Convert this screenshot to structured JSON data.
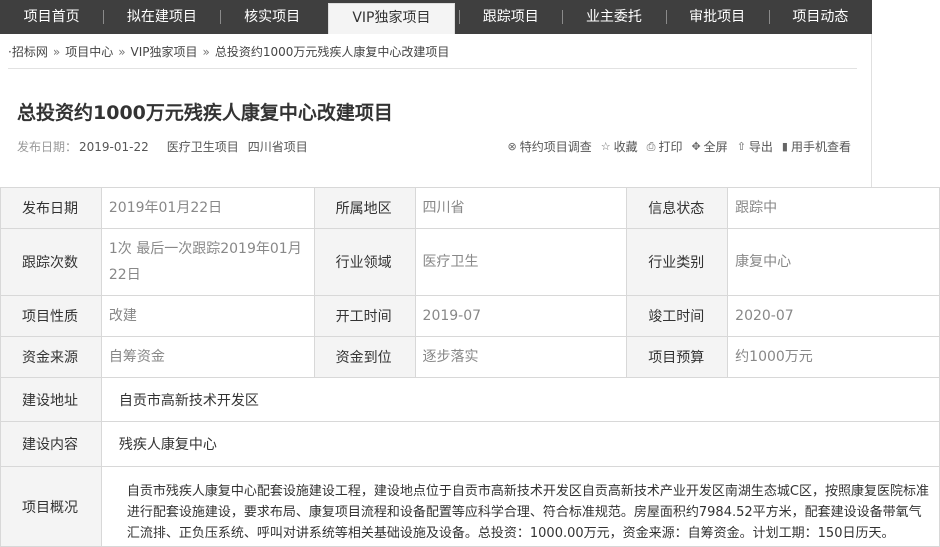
{
  "nav": {
    "items": [
      {
        "label": "项目首页"
      },
      {
        "label": "拟在建项目"
      },
      {
        "label": "核实项目"
      },
      {
        "label": "VIP独家项目"
      },
      {
        "label": "跟踪项目"
      },
      {
        "label": "业主委托"
      },
      {
        "label": "审批项目"
      },
      {
        "label": "项目动态"
      }
    ],
    "active_index": 3
  },
  "breadcrumb": {
    "bullet": "·",
    "items": [
      "招标网",
      "项目中心",
      "VIP独家项目",
      "总投资约1000万元残疾人康复中心改建项目"
    ],
    "separator": "»"
  },
  "header": {
    "title": "总投资约1000万元残疾人康复中心改建项目",
    "publish_label": "发布日期：",
    "publish_date": "2019-01-22",
    "tag_industry": "医疗卫生项目",
    "tag_region": "四川省项目"
  },
  "actions": [
    {
      "icon": "survey-icon",
      "glyph": "⊗",
      "label": "特约项目调查"
    },
    {
      "icon": "star-icon",
      "glyph": "☆",
      "label": "收藏"
    },
    {
      "icon": "print-icon",
      "glyph": "⎙",
      "label": "打印"
    },
    {
      "icon": "fullscreen-icon",
      "glyph": "✥",
      "label": "全屏"
    },
    {
      "icon": "export-icon",
      "glyph": "⇧",
      "label": "导出"
    },
    {
      "icon": "mobile-icon",
      "glyph": "▮",
      "label": "用手机查看"
    }
  ],
  "details": {
    "publish_date_label": "发布日期",
    "publish_date_value": "2019年01月22日",
    "region_label": "所属地区",
    "region_value": "四川省",
    "status_label": "信息状态",
    "status_value": "跟踪中",
    "track_label": "跟踪次数",
    "track_value": "1次 最后一次跟踪2019年01月22日",
    "industry_label": "行业领域",
    "industry_value": "医疗卫生",
    "category_label": "行业类别",
    "category_value": "康复中心",
    "nature_label": "项目性质",
    "nature_value": "改建",
    "start_label": "开工时间",
    "start_value": "2019-07",
    "end_label": "竣工时间",
    "end_value": "2020-07",
    "fund_source_label": "资金来源",
    "fund_source_value": "自筹资金",
    "fund_arrival_label": "资金到位",
    "fund_arrival_value": "逐步落实",
    "budget_label": "项目预算",
    "budget_value": "约1000万元",
    "address_label": "建设地址",
    "address_value": "自贡市高新技术开发区",
    "content_label": "建设内容",
    "content_value": "残疾人康复中心",
    "overview_label": "项目概况",
    "overview_value": "自贡市残疾人康复中心配套设施建设工程，建设地点位于自贡市高新技术开发区自贡高新技术产业开发区南湖生态城C区，按照康复医院标准进行配套设施建设，要求布局、康复项目流程和设备配置等应科学合理、符合标准规范。房屋面积约7984.52平方米，配套建设设备带氧气汇流排、正负压系统、呼叫对讲系统等相关基础设施及设备。总投资：1000.00万元，资金来源：自筹资金。计划工期：150日历天。"
  }
}
